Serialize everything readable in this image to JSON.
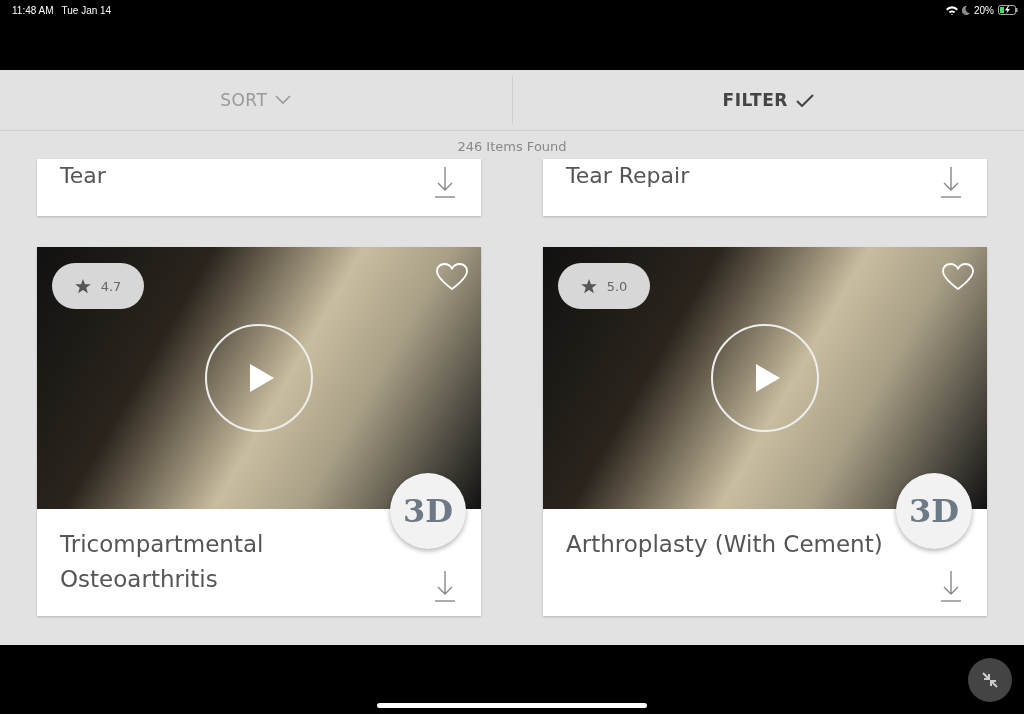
{
  "status_bar": {
    "time": "11:48 AM",
    "date": "Tue Jan 14",
    "battery": "20%",
    "charging": true
  },
  "toolbar": {
    "tabs": [
      {
        "label": "SORT",
        "kind": "dropdown",
        "selected": false
      },
      {
        "label": "FILTER",
        "kind": "check",
        "selected": true
      }
    ]
  },
  "results_count": "246 Items Found",
  "cards": [
    {
      "kind": "compact",
      "title": "Tear"
    },
    {
      "kind": "compact",
      "title": "Tear Repair"
    },
    {
      "kind": "media",
      "title": "Tricompartmental Osteoarthritis",
      "rating": "4.7",
      "favorite": false,
      "badge": "3D"
    },
    {
      "kind": "media",
      "title": "Arthroplasty (With Cement)",
      "rating": "5.0",
      "favorite": false,
      "badge": "3D"
    }
  ]
}
